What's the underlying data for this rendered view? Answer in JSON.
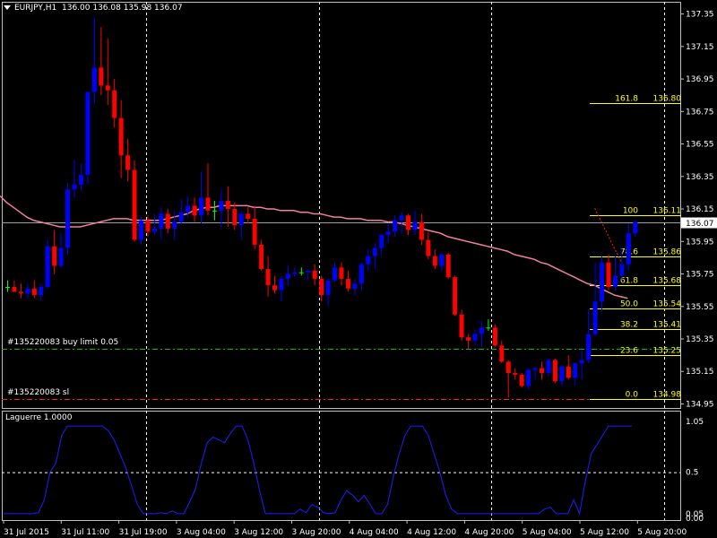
{
  "header": {
    "symbol": "EURJPY,H1",
    "ohlc": "136.00 136.08 135.98 136.07"
  },
  "indicator": {
    "label": "Laguerre 1.0000"
  },
  "orders": [
    {
      "label": "#135220083 buy limit 0.05",
      "price": 135.29,
      "color": "#00c000"
    },
    {
      "label": "#135220083 sl",
      "price": 134.98,
      "color": "#ff2020"
    }
  ],
  "current_price": 136.07,
  "price_axis": {
    "min": 134.925,
    "max": 137.425,
    "ticks": [
      "137.35",
      "137.15",
      "136.95",
      "136.75",
      "136.55",
      "136.35",
      "136.15",
      "135.95",
      "135.75",
      "135.55",
      "135.35",
      "135.15",
      "134.95"
    ]
  },
  "indicator_axis": {
    "min": 0,
    "max": 1.05,
    "ticks": [
      "1.05",
      "0.5",
      "0.05",
      "0.00"
    ]
  },
  "time_axis": [
    "31 Jul 2015",
    "31 Jul 11:00",
    "31 Jul 19:00",
    "3 Aug 04:00",
    "3 Aug 12:00",
    "3 Aug 20:00",
    "4 Aug 04:00",
    "4 Aug 12:00",
    "4 Aug 20:00",
    "5 Aug 04:00",
    "5 Aug 12:00",
    "5 Aug 20:00"
  ],
  "fibonacci": {
    "color": "#ffff00",
    "levels": [
      {
        "ratio": "161.8",
        "price": "136.80"
      },
      {
        "ratio": "100",
        "price": "136.11"
      },
      {
        "ratio": "78.6",
        "price": "135.86"
      },
      {
        "ratio": "61.8",
        "price": "135.68"
      },
      {
        "ratio": "50.0",
        "price": "135.54"
      },
      {
        "ratio": "38.2",
        "price": "135.41"
      },
      {
        "ratio": "23.6",
        "price": "135.25"
      },
      {
        "ratio": "0.0",
        "price": "134.98"
      }
    ]
  },
  "chart_data": {
    "type": "candlestick",
    "colors": {
      "bull": "#0000ff",
      "bear": "#ff0000",
      "doji": "#00ff00",
      "ma": "#f080a0",
      "laguerre": "#1e1eff",
      "grid": "#ffffff"
    },
    "ohlc": [
      [
        135.67,
        135.71,
        135.64,
        135.67
      ],
      [
        135.67,
        135.71,
        135.64,
        135.64
      ],
      [
        135.64,
        135.69,
        135.6,
        135.63
      ],
      [
        135.63,
        135.69,
        135.6,
        135.66
      ],
      [
        135.66,
        135.71,
        135.6,
        135.62
      ],
      [
        135.62,
        135.69,
        135.59,
        135.67
      ],
      [
        135.67,
        135.96,
        135.66,
        135.92
      ],
      [
        135.92,
        136.02,
        135.75,
        135.8
      ],
      [
        135.8,
        136.0,
        135.79,
        135.91
      ],
      [
        135.91,
        136.31,
        135.87,
        136.27
      ],
      [
        136.27,
        136.45,
        136.22,
        136.3
      ],
      [
        136.3,
        136.43,
        136.26,
        136.36
      ],
      [
        136.36,
        136.78,
        136.3,
        136.87
      ],
      [
        136.87,
        137.33,
        136.8,
        137.02
      ],
      [
        137.02,
        137.27,
        136.85,
        136.91
      ],
      [
        136.91,
        137.2,
        136.79,
        136.88
      ],
      [
        136.88,
        136.95,
        136.65,
        136.71
      ],
      [
        136.71,
        136.82,
        136.34,
        136.48
      ],
      [
        136.48,
        136.58,
        136.32,
        136.39
      ],
      [
        136.39,
        136.45,
        135.95,
        135.96
      ],
      [
        135.96,
        136.1,
        135.93,
        136.08
      ],
      [
        136.08,
        136.11,
        135.98,
        136.01
      ],
      [
        136.01,
        136.12,
        135.99,
        136.03
      ],
      [
        136.03,
        136.16,
        135.96,
        136.12
      ],
      [
        136.12,
        136.15,
        136.0,
        136.03
      ],
      [
        136.03,
        136.14,
        135.96,
        136.07
      ],
      [
        136.07,
        136.21,
        136.05,
        136.13
      ],
      [
        136.13,
        136.23,
        136.1,
        136.17
      ],
      [
        136.17,
        136.22,
        136.07,
        136.11
      ],
      [
        136.11,
        136.38,
        136.06,
        136.22
      ],
      [
        136.22,
        136.43,
        136.11,
        136.14
      ],
      [
        136.14,
        136.2,
        136.08,
        136.14
      ],
      [
        136.14,
        136.27,
        136.04,
        136.2
      ],
      [
        136.2,
        136.29,
        136.04,
        136.15
      ],
      [
        136.15,
        136.19,
        136.02,
        136.05
      ],
      [
        136.05,
        136.14,
        135.96,
        136.12
      ],
      [
        136.12,
        136.16,
        136.06,
        136.09
      ],
      [
        136.09,
        136.17,
        135.9,
        135.93
      ],
      [
        135.93,
        135.96,
        135.77,
        135.78
      ],
      [
        135.78,
        135.86,
        135.61,
        135.68
      ],
      [
        135.68,
        135.74,
        135.63,
        135.65
      ],
      [
        135.65,
        135.74,
        135.58,
        135.72
      ],
      [
        135.72,
        135.8,
        135.68,
        135.75
      ],
      [
        135.75,
        135.79,
        135.73,
        135.76
      ],
      [
        135.76,
        135.79,
        135.74,
        135.76
      ],
      [
        135.76,
        135.78,
        135.71,
        135.77
      ],
      [
        135.77,
        135.81,
        135.68,
        135.72
      ],
      [
        135.72,
        135.74,
        135.58,
        135.62
      ],
      [
        135.62,
        135.72,
        135.55,
        135.71
      ],
      [
        135.71,
        135.82,
        135.7,
        135.79
      ],
      [
        135.79,
        135.82,
        135.68,
        135.72
      ],
      [
        135.72,
        135.77,
        135.64,
        135.66
      ],
      [
        135.66,
        135.72,
        135.62,
        135.69
      ],
      [
        135.69,
        135.82,
        135.65,
        135.81
      ],
      [
        135.81,
        135.9,
        135.77,
        135.86
      ],
      [
        135.86,
        135.94,
        135.78,
        135.91
      ],
      [
        135.91,
        136.0,
        135.86,
        135.99
      ],
      [
        135.99,
        136.06,
        135.94,
        136.01
      ],
      [
        136.01,
        136.11,
        135.98,
        136.08
      ],
      [
        136.08,
        136.13,
        136.0,
        136.11
      ],
      [
        136.11,
        136.12,
        135.99,
        136.02
      ],
      [
        136.02,
        136.14,
        135.99,
        136.07
      ],
      [
        136.07,
        136.12,
        135.93,
        135.96
      ],
      [
        135.96,
        136.01,
        135.84,
        135.86
      ],
      [
        135.86,
        135.9,
        135.78,
        135.8
      ],
      [
        135.8,
        135.88,
        135.77,
        135.87
      ],
      [
        135.87,
        135.88,
        135.72,
        135.73
      ],
      [
        135.73,
        135.74,
        135.49,
        135.5
      ],
      [
        135.5,
        135.53,
        135.34,
        135.36
      ],
      [
        135.36,
        135.38,
        135.29,
        135.34
      ],
      [
        135.34,
        135.41,
        135.31,
        135.38
      ],
      [
        135.38,
        135.46,
        135.3,
        135.42
      ],
      [
        135.42,
        135.47,
        135.4,
        135.42
      ],
      [
        135.42,
        135.44,
        135.3,
        135.31
      ],
      [
        135.31,
        135.34,
        135.2,
        135.21
      ],
      [
        135.21,
        135.22,
        134.99,
        135.14
      ],
      [
        135.14,
        135.17,
        135.1,
        135.13
      ],
      [
        135.13,
        135.14,
        135.05,
        135.06
      ],
      [
        135.06,
        135.17,
        135.04,
        135.16
      ],
      [
        135.16,
        135.18,
        135.1,
        135.17
      ],
      [
        135.17,
        135.21,
        135.1,
        135.14
      ],
      [
        135.14,
        135.23,
        135.12,
        135.22
      ],
      [
        135.22,
        135.23,
        135.08,
        135.09
      ],
      [
        135.09,
        135.19,
        135.06,
        135.18
      ],
      [
        135.18,
        135.25,
        135.1,
        135.11
      ],
      [
        135.11,
        135.2,
        135.06,
        135.2
      ],
      [
        135.2,
        135.28,
        135.1,
        135.22
      ],
      [
        135.22,
        135.53,
        135.2,
        135.38
      ],
      [
        135.38,
        135.82,
        135.37,
        135.58
      ],
      [
        135.58,
        135.86,
        135.52,
        135.82
      ],
      [
        135.82,
        135.87,
        135.65,
        135.67
      ],
      [
        135.67,
        135.86,
        135.65,
        135.74
      ],
      [
        135.74,
        135.91,
        135.71,
        135.81
      ],
      [
        135.81,
        136.06,
        135.77,
        136.0
      ],
      [
        136.0,
        136.08,
        135.98,
        136.07
      ]
    ],
    "ma": [
      136.23,
      136.19,
      136.16,
      136.13,
      136.1,
      136.08,
      136.07,
      136.06,
      136.05,
      136.04,
      136.04,
      136.04,
      136.04,
      136.05,
      136.06,
      136.07,
      136.08,
      136.09,
      136.09,
      136.09,
      136.08,
      136.08,
      136.08,
      136.08,
      136.08,
      136.09,
      136.1,
      136.11,
      136.12,
      136.14,
      136.15,
      136.16,
      136.16,
      136.17,
      136.17,
      136.17,
      136.17,
      136.17,
      136.16,
      136.16,
      136.15,
      136.15,
      136.14,
      136.14,
      136.14,
      136.13,
      136.13,
      136.12,
      136.12,
      136.11,
      136.1,
      136.1,
      136.09,
      136.09,
      136.09,
      136.08,
      136.08,
      136.08,
      136.07,
      136.07,
      136.06,
      136.05,
      136.04,
      136.03,
      136.02,
      136.01,
      136.0,
      135.98,
      135.97,
      135.96,
      135.95,
      135.94,
      135.93,
      135.92,
      135.91,
      135.9,
      135.89,
      135.87,
      135.86,
      135.85,
      135.84,
      135.82,
      135.81,
      135.79,
      135.77,
      135.75,
      135.73,
      135.71,
      135.69,
      135.68,
      135.66,
      135.64,
      135.62,
      135.61,
      135.6
    ],
    "laguerre": [
      0.05,
      0.05,
      0.05,
      0.05,
      0.05,
      0.05,
      0.06,
      0.2,
      0.5,
      0.6,
      0.9,
      1.0,
      1.0,
      1.0,
      1.0,
      1.0,
      1.0,
      1.0,
      0.95,
      0.85,
      0.7,
      0.55,
      0.35,
      0.15,
      0.05,
      0.05,
      0.05,
      0.06,
      0.05,
      0.08,
      0.05,
      0.05,
      0.18,
      0.32,
      0.6,
      0.82,
      0.88,
      0.85,
      0.82,
      0.92,
      1.0,
      1.0,
      0.85,
      0.6,
      0.3,
      0.05,
      0.05,
      0.05,
      0.05,
      0.05,
      0.05,
      0.1,
      0.06,
      0.15,
      0.12,
      0.06,
      0.05,
      0.06,
      0.2,
      0.3,
      0.25,
      0.18,
      0.25,
      0.15,
      0.05,
      0.05,
      0.15,
      0.45,
      0.7,
      0.9,
      1.0,
      1.0,
      1.0,
      0.9,
      0.7,
      0.5,
      0.25,
      0.1,
      0.05,
      0.05,
      0.05,
      0.05,
      0.05,
      0.05,
      0.05,
      0.05,
      0.05,
      0.05,
      0.05,
      0.05,
      0.05,
      0.05,
      0.05,
      0.1,
      0.12,
      0.05,
      0.05,
      0.05,
      0.2,
      0.05,
      0.4,
      0.7,
      0.8,
      0.9,
      1.0,
      1.0,
      1.0,
      1.0,
      1.0
    ],
    "price_range": [
      134.925,
      137.425
    ],
    "indicator_range": [
      0,
      1.05
    ]
  }
}
